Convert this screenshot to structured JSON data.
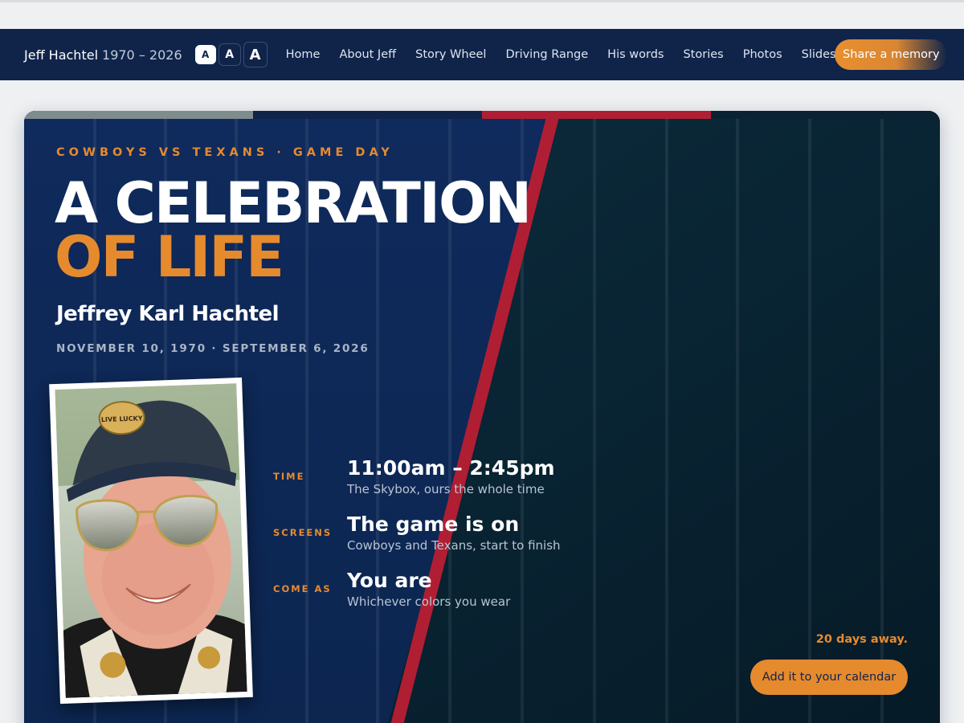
{
  "nav": {
    "brand_name": "Jeff Hachtel",
    "brand_years": "1970 – 2026",
    "font_sizes": [
      "A",
      "A",
      "A"
    ],
    "links": [
      "Home",
      "About Jeff",
      "Story Wheel",
      "Driving Range",
      "His words",
      "Stories",
      "Photos",
      "Slideshow"
    ],
    "share_label": "Share a memory"
  },
  "hero": {
    "eyebrow": "COWBOYS VS TEXANS · GAME DAY",
    "title_line1": "A CELEBRATION",
    "title_line2": "OF LIFE",
    "full_name": "Jeffrey Karl Hachtel",
    "dates": "NOVEMBER 10, 1970 · SEPTEMBER 6, 2026",
    "hat_text": "LIVE LUCKY",
    "details": [
      {
        "label": "TIME",
        "main": "11:00am – 2:45pm",
        "sub": "The Skybox, ours the whole time"
      },
      {
        "label": "SCREENS",
        "main": "The game is on",
        "sub": "Cowboys and Texans, start to finish"
      },
      {
        "label": "COME AS",
        "main": "You are",
        "sub": "Whichever colors you wear"
      }
    ],
    "countdown": "20 days away.",
    "calendar_label": "Add it to your calendar"
  },
  "colors": {
    "navy": "#10244a",
    "orange": "#e68a2e",
    "red": "#b01e33",
    "teal_dark": "#0a2a3a",
    "stripe_gray": "#7f8c8d"
  }
}
